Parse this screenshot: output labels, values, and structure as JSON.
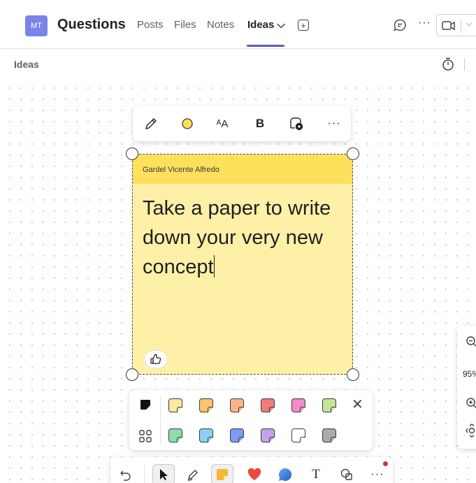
{
  "header": {
    "avatar_initials": "MT",
    "title": "Questions",
    "tabs": [
      {
        "label": "Posts"
      },
      {
        "label": "Files"
      },
      {
        "label": "Notes"
      },
      {
        "label": "Ideas ⌵"
      }
    ],
    "add_tab_symbol": "+",
    "more_symbol": "···",
    "video_chevron": "⌵"
  },
  "subheader": {
    "title": "Ideas"
  },
  "note_toolbar": {
    "text_size_label": "ᴬA",
    "bold_label": "B",
    "more_label": "···"
  },
  "note": {
    "author": "Gardel Vicente Alfredo",
    "text": "Take a paper to write down your very new concept",
    "header_color": "#fde05c",
    "body_color": "#fff0a8"
  },
  "palette": {
    "close_label": "✕",
    "colors_row1": [
      "#fde9a3",
      "#fcc56d",
      "#f8b58c",
      "#f07c7c",
      "#f08cc8",
      "#c5e59a"
    ],
    "colors_row2": [
      "#8fdcb0",
      "#8ccff0",
      "#7c9cf0",
      "#c4a3e6",
      "#ffffff",
      "#aaaaaa"
    ]
  },
  "bottom_toolbar": {
    "text_tool_label": "T",
    "more_label": "···"
  },
  "zoom": {
    "level": "95%"
  },
  "colors": {
    "accent": "#5b5fc7",
    "avatar": "#7b83eb",
    "notification": "#d13438"
  }
}
